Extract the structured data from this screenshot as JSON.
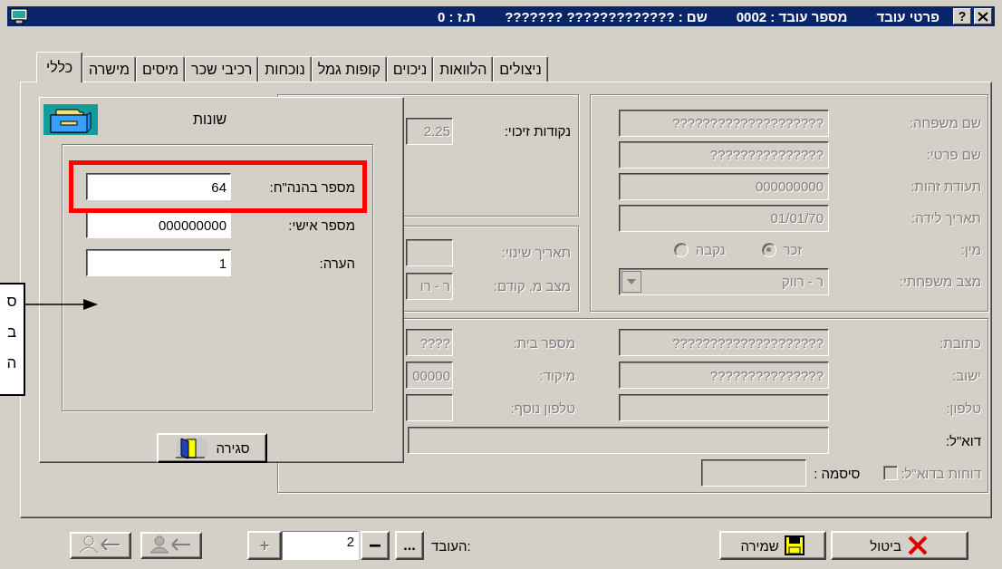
{
  "window": {
    "title": [
      "פרטי עובד",
      "מספר עובד : 0002",
      "שם : ????????????? ???????",
      "ת.ז : 0"
    ],
    "help": "?"
  },
  "tabs": [
    {
      "label": "ניצולים",
      "selected": false
    },
    {
      "label": "הלוואות",
      "selected": false
    },
    {
      "label": "ניכוים",
      "selected": false
    },
    {
      "label": "קופות גמל",
      "selected": false
    },
    {
      "label": "נוכחות",
      "selected": false
    },
    {
      "label": "רכיבי שכר",
      "selected": false
    },
    {
      "label": "מיסים",
      "selected": false
    },
    {
      "label": "מישרה",
      "selected": false
    },
    {
      "label": "כללי",
      "selected": true
    }
  ],
  "personal": {
    "fields": [
      {
        "label": "שם משפחה:",
        "value": "????????????????????",
        "disabled": true
      },
      {
        "label": "שם פרטי:",
        "value": "???????????????",
        "disabled": true
      },
      {
        "label": "תעודת זהות:",
        "value": "000000000",
        "disabled": true
      },
      {
        "label": "תאריך לידה:",
        "value": "01/01/70",
        "disabled": true
      }
    ],
    "gender": {
      "label": "מין:",
      "disabled": true,
      "options": [
        {
          "label": "זכר",
          "selected": true
        },
        {
          "label": "נקבה",
          "selected": false
        }
      ]
    },
    "marital": {
      "label": "מצב משפחתי:",
      "value": "ר - רווק",
      "disabled": true
    }
  },
  "credit_points": {
    "label": "נקודות זיכוי:",
    "value": "2.25",
    "disabled": false
  },
  "changes": {
    "fields": [
      {
        "label": "תאריך שינוי:",
        "disabled": true
      },
      {
        "label": "מצב מ. קודם:",
        "value": "ר - רו",
        "disabled": true
      }
    ]
  },
  "address": {
    "rows": [
      {
        "fields": [
          {
            "label": "כתובת:",
            "value": "????????????????????",
            "disabled": true
          },
          {
            "label": "מספר בית:",
            "value": "????",
            "disabled": true
          }
        ]
      },
      {
        "fields": [
          {
            "label": "ישוב:",
            "value": "???????????????",
            "disabled": true
          },
          {
            "label": "מיקוד:",
            "value": "00000",
            "disabled": true
          }
        ]
      },
      {
        "fields": [
          {
            "label": "טלפון:",
            "disabled": true
          },
          {
            "label": "טלפון נוסף:",
            "disabled": true
          }
        ]
      }
    ],
    "email": {
      "label": "דוא\"ל:",
      "disabled": false
    },
    "reports": {
      "label": "דוחות בדוא\"ל:",
      "checked": false,
      "disabled": true
    },
    "password": {
      "label": "סיסמה :",
      "disabled": false
    }
  },
  "popup": {
    "title": "שונות",
    "fields": [
      {
        "label": "מספר בהנה\"ח:",
        "value": "64",
        "highlighted": true
      },
      {
        "label": "מספר אישי:",
        "value": "000000000",
        "highlighted": false
      },
      {
        "label": "הערה:",
        "value": "1",
        "highlighted": false
      }
    ],
    "close_button": "סגירה"
  },
  "callout": {
    "lines": [
      "ס",
      "ב",
      "ה"
    ]
  },
  "footer": {
    "cancel": "ביטול",
    "save": "שמירה",
    "employee_label": "העובד:",
    "browse": "...",
    "minus": "−",
    "employee": "2",
    "plus": "+",
    "plus_disabled": true
  }
}
